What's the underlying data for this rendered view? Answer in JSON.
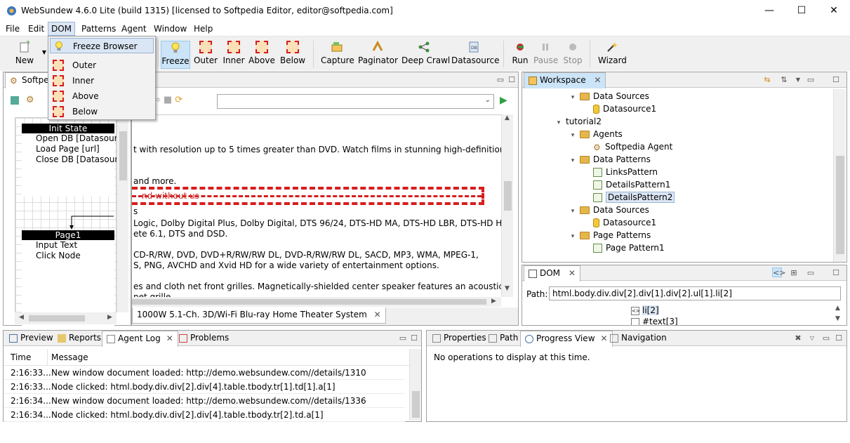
{
  "window": {
    "title": "WebSundew 4.6.0 Lite (build 1315) [licensed to Softpedia Editor, editor@softpedia.com]",
    "minimize": "—",
    "maximize": "☐",
    "close": "✕"
  },
  "menu": [
    "File",
    "Edit",
    "DOM",
    "Patterns",
    "Agent",
    "Window",
    "Help"
  ],
  "dom_menu": {
    "items": [
      "Freeze Browser",
      "Outer",
      "Inner",
      "Above",
      "Below"
    ]
  },
  "toolbar": {
    "new": "New",
    "freeze": "Freeze",
    "outer": "Outer",
    "inner": "Inner",
    "above": "Above",
    "below": "Below",
    "capture": "Capture",
    "paginator": "Paginator",
    "deep_crawl": "Deep Crawl",
    "datasource": "Datasource",
    "run": "Run",
    "pause": "Pause",
    "stop": "Stop",
    "wizard": "Wizard"
  },
  "left_panel": {
    "tab": "Softpe",
    "init_state": {
      "title": "Init State",
      "lines": [
        "Open DB [Datasource",
        "Load Page [url]",
        "Close DB [Datasource"
      ]
    },
    "page1": {
      "title": "Page1",
      "lines": [
        "Input Text",
        "Click Node"
      ]
    }
  },
  "browser": {
    "tab": "1000W 5.1-Ch. 3D/Wi-Fi Blu-ray Home Theater System",
    "url": "",
    "lines": [
      "t with resolution up to 5 times greater than DVD. Watch films in stunning high-definition just",
      "and more.",
      "s",
      "Logic, Dolby Digital Plus, Dolby Digital, DTS 96/24, DTS-HD MA, DTS-HD LBR, DTS-HD HR,",
      "ete 6.1, DTS and DSD.",
      "CD-R/RW, DVD, DVD+R/RW/RW DL, DVD-R/RW/RW DL, SACD, MP3, WMA, MPEG-1,",
      "S, PNG, AVCHD and Xvid HD for a wide variety of entertainment options.",
      "es and cloth net front grilles. Magnetically-shielded center speaker features an acoustic",
      "net grille"
    ],
    "obscured": "nd without us"
  },
  "workspace": {
    "tab": "Workspace",
    "tree": [
      {
        "label": "Data Sources",
        "kind": "folder",
        "level": 2,
        "twisty": "▾"
      },
      {
        "label": "Datasource1",
        "kind": "db",
        "level": 3,
        "twisty": ""
      },
      {
        "label": "tutorial2",
        "kind": "text",
        "level": 1,
        "twisty": "▾"
      },
      {
        "label": "Agents",
        "kind": "folder",
        "level": 2,
        "twisty": "▾"
      },
      {
        "label": "Softpedia Agent",
        "kind": "gear",
        "level": 3,
        "twisty": ""
      },
      {
        "label": "Data Patterns",
        "kind": "folder",
        "level": 2,
        "twisty": "▾"
      },
      {
        "label": "LinksPattern",
        "kind": "pattern",
        "level": 3,
        "twisty": ""
      },
      {
        "label": "DetailsPattern1",
        "kind": "pattern",
        "level": 3,
        "twisty": ""
      },
      {
        "label": "DetailsPattern2",
        "kind": "pattern",
        "level": 3,
        "twisty": "",
        "selected": true
      },
      {
        "label": "Data Sources",
        "kind": "folder",
        "level": 2,
        "twisty": "▾"
      },
      {
        "label": "Datasource1",
        "kind": "db",
        "level": 3,
        "twisty": ""
      },
      {
        "label": "Page Patterns",
        "kind": "folder",
        "level": 2,
        "twisty": "▾"
      },
      {
        "label": "Page Pattern1",
        "kind": "pattern",
        "level": 3,
        "twisty": ""
      }
    ]
  },
  "dom_panel": {
    "tab": "DOM",
    "path_label": "Path:",
    "path_value": "html.body.div.div[2].div[1].div[2].ul[1].li[2]",
    "nodes": [
      "li[2]",
      "#text[3]"
    ]
  },
  "bottom_left": {
    "tabs": [
      "Preview",
      "Reports",
      "Agent Log",
      "Problems"
    ],
    "columns": [
      "Time",
      "Message"
    ],
    "rows": [
      {
        "time": "2:16:33...",
        "message": "New window document loaded: http://demo.websundew.com//details/1310"
      },
      {
        "time": "2:16:33...",
        "message": "Node clicked: html.body.div.div[2].div[4].table.tbody.tr[1].td[1].a[1]"
      },
      {
        "time": "2:16:34...",
        "message": "New window document loaded: http://demo.websundew.com//details/1336"
      },
      {
        "time": "2:16:34...",
        "message": "Node clicked: html.body.div.div[2].div[4].table.tbody.tr[2].td.a[1]"
      }
    ]
  },
  "bottom_right": {
    "tabs": [
      "Properties",
      "Path",
      "Progress View",
      "Navigation"
    ],
    "message": "No operations to display at this time."
  },
  "colors": {
    "accent": "#cce4f7",
    "selection": "#dbe6f4",
    "red_dash": "#d71d1d",
    "run_green": "#2ea043"
  }
}
